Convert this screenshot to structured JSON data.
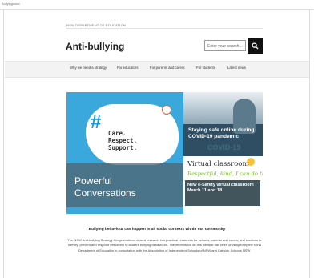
{
  "browser": {
    "url_fragment": "Bullyingwww"
  },
  "gov_banner": {
    "text": "NSW DEPARTMENT OF EDUCATION"
  },
  "site": {
    "title": "Anti-bullying"
  },
  "search": {
    "placeholder": "Enter your search...",
    "button_icon": "search-icon"
  },
  "nav": {
    "items": [
      {
        "label": "Why we need a strategy"
      },
      {
        "label": "For educators"
      },
      {
        "label": "For parents and carers"
      },
      {
        "label": "For students"
      },
      {
        "label": "Latest news"
      }
    ]
  },
  "hero": {
    "left": {
      "hashtag": "#",
      "care_lines": [
        "Care.",
        "Respect.",
        "Support."
      ],
      "caption_lines": [
        "Powerful",
        "Conversations"
      ]
    },
    "top_right": {
      "title": "Staying safe online during COVID-19 pandemic",
      "overlay_text": "COVID-19"
    },
    "bottom_right": {
      "title": "Virtual classroom",
      "script": "Respectful, kind, I can do that!",
      "caption": "New e-Safety virtual classroom March 11 and 18"
    }
  },
  "content": {
    "heading": "Bullying behaviour can happen in all social contexts within our community",
    "paragraph": "The NSW Anti-bullying Strategy brings evidence-based research into practical resources for schools, parents and carers, and students to identify, prevent and respond effectively to student bullying behaviours. The information on this website has been developed by the NSW Department of Education in consultation with the Association of Independent Schools of NSW and Catholic Schools NSW."
  },
  "colors": {
    "accent_blue": "#3aa8dc",
    "dark": "#111111",
    "nav_bg": "#f3f3f3"
  }
}
